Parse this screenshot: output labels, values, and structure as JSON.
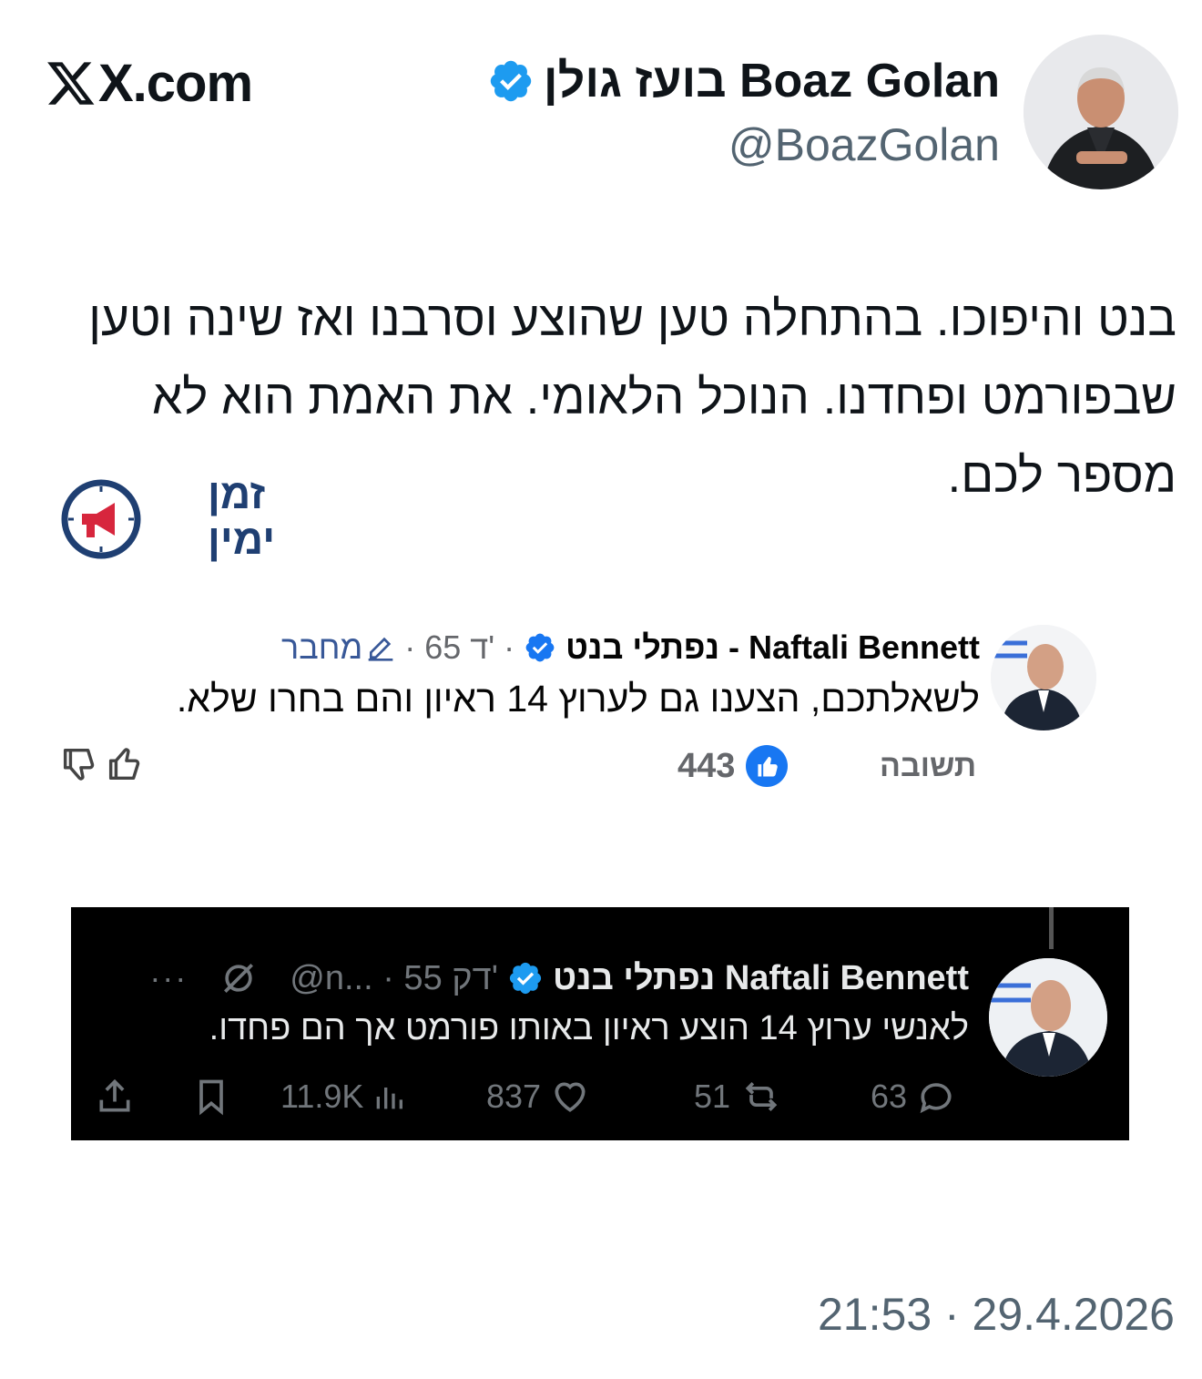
{
  "header": {
    "site": "X.com",
    "author_name": "בועז גולן Boaz Golan",
    "author_handle": "@BoazGolan"
  },
  "tweet": {
    "text": "בנט והיפוכו. בהתחלה טען שהוצע וסרבנו ואז שינה וטען שבפורמט ופחדנו. הנוכל הלאומי. את האמת הוא לא מספר לכם.",
    "timestamp": "21:53 · 29.4.2026"
  },
  "channel_logo": {
    "line1": "זמן",
    "line2": "ימין"
  },
  "facebook_comment": {
    "author": "נפתלי  בנט - Naftali Bennett",
    "meta": "· 65 ד' ·",
    "edit_label": "מחבר",
    "text": "לשאלתכם, הצענו גם לערוץ 14 ראיון והם בחרו שלא.",
    "reply_label": "תשובה",
    "like_count": "443"
  },
  "embedded_tweet": {
    "author": "נפתלי בנט Naftali Bennett",
    "meta": "@n... · 55 דק'",
    "text": "לאנשי ערוץ 14 הוצע ראיון באותו פורמט אך הם פחדו.",
    "replies": "63",
    "reposts": "51",
    "likes": "837",
    "views": "11.9K"
  },
  "colors": {
    "verified_blue": "#1d9bf0",
    "facebook_blue": "#1877f2",
    "logo_navy": "#1f3f72",
    "logo_red": "#d7263d"
  }
}
